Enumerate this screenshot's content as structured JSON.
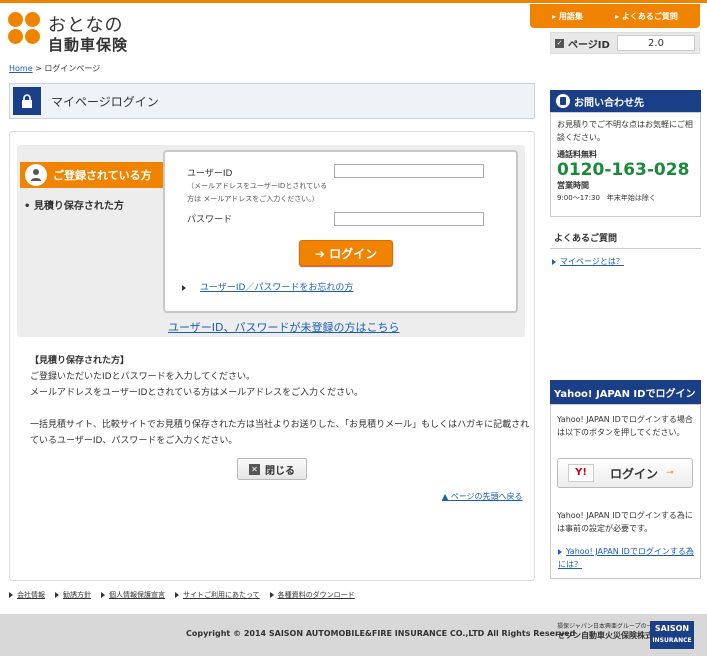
{
  "header": {
    "logo_line1": "おとなの",
    "logo_line2": "自動車保険",
    "tabs": [
      "▸ 用語集",
      "▸ よくあるご質問"
    ],
    "page_id_label": "ページID",
    "page_id_value": "2.0"
  },
  "breadcrumb": {
    "home": "Home",
    "sep": ">",
    "current": "ログインページ"
  },
  "page_title": "マイページログイン",
  "login": {
    "tag_label": "ご登録されている方",
    "tag_sub": "• 見積り保存された方",
    "userid_label": "ユーザーID",
    "userid_note": "（メールアドレスをユーザーIDとされている方は メールアドレスをご入力ください。）",
    "password_label": "パスワード",
    "userid_value": "",
    "password_value": "",
    "login_button": "➔ ログイン",
    "forgot_link": "ユーザーID／パスワードをお忘れの方",
    "unregistered_link": "ユーザーID、パスワードが未登録の方はこちら"
  },
  "info": {
    "heading": "【見積り保存された方】",
    "line1": "ご登録いただいたIDとパスワードを入力してください。",
    "line2": "メールアドレスをユーザーIDとされている方はメールアドレスをご入力ください。",
    "line3": "一括見積サイト、比較サイトでお見積り保存された方は当社よりお送りした、「お見積りメール」もしくはハガキに記載されているユーザーID、パスワードをご入力ください。"
  },
  "close_button": "閉じる",
  "back_to_top": "ページの先頭へ戻る",
  "sidebar": {
    "contact_title": "お問い合わせ先",
    "contact_text": "お見積りでご不明な点はお気軽にご相談ください。",
    "tel_label": "通話料無料",
    "tel_number": "0120-163-028",
    "hours_label": "営業時間",
    "hours": "9:00～17:30　年末年始は除く",
    "faq_title": "よくあるご質問",
    "faq_link": "マイページとは？",
    "yahoo_title": "Yahoo! JAPAN IDでログイン",
    "yahoo_text1": "Yahoo! JAPAN IDでログインする場合は以下のボタンを押してください。",
    "yahoo_logo": "Y!",
    "yahoo_button": "ログイン",
    "yahoo_text2": "Yahoo! JAPAN IDでログインする為には事前の設定が必要です。",
    "yahoo_link": "Yahoo! JAPAN IDでログインする為には？"
  },
  "footer": {
    "links": [
      "会社情報",
      "勧誘方針",
      "個人情報保護宣言",
      "サイトご利用にあたって",
      "各種資料のダウンロード"
    ],
    "copyright": "Copyright © 2014 SAISON AUTOMOBILE&FIRE INSURANCE CO.,LTD All Rights Reserved",
    "company_small": "損保ジャパン日本興亜グループの一員です",
    "company_name": "セゾン自動車火災保険株式会社",
    "logo_text1": "SAISON",
    "logo_text2": "INSURANCE"
  }
}
